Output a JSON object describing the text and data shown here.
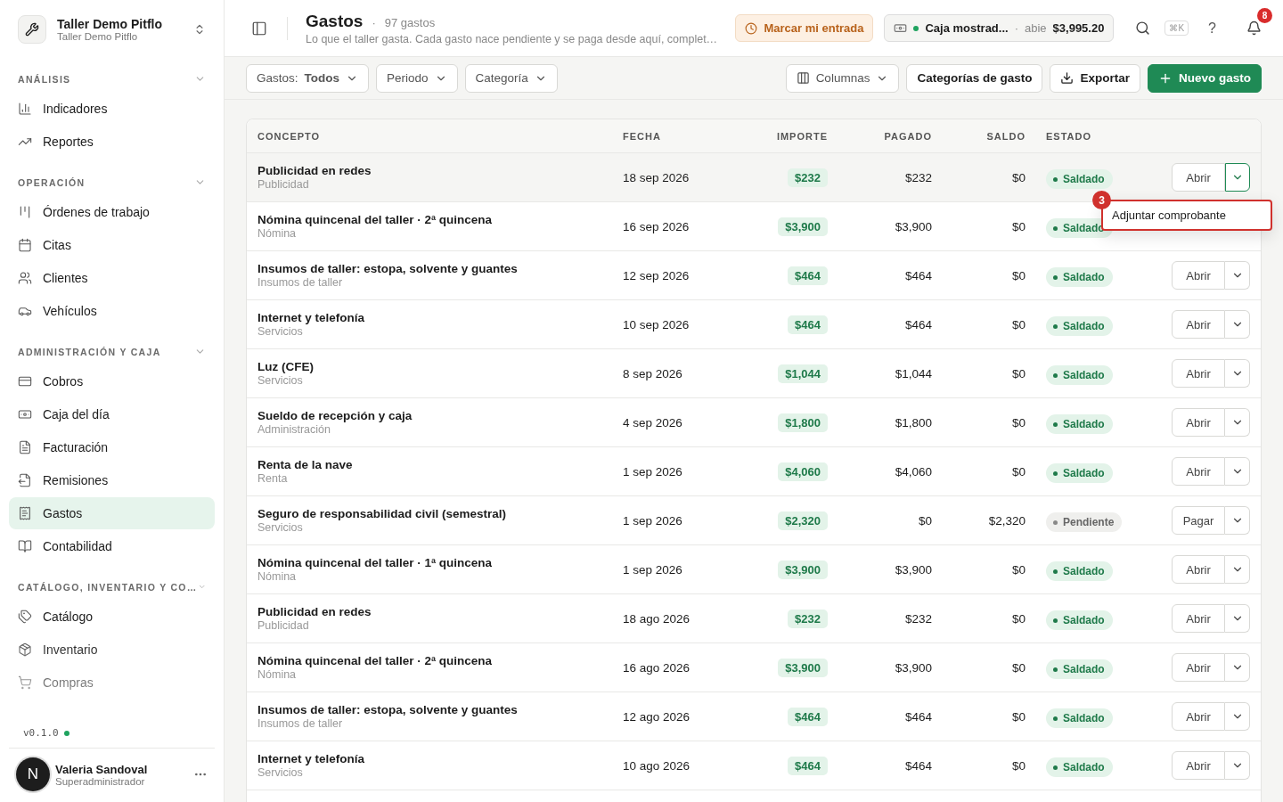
{
  "sidebar": {
    "workspace": {
      "name": "Taller Demo Pitflo",
      "subtitle": "Taller Demo Pitflo"
    },
    "sections": [
      {
        "title": "ANÁLISIS",
        "expanded": true,
        "items": [
          {
            "label": "Indicadores",
            "kind": "chart",
            "selected": false
          },
          {
            "label": "Reportes",
            "kind": "trend",
            "selected": false
          }
        ]
      },
      {
        "title": "OPERACIÓN",
        "expanded": true,
        "items": [
          {
            "label": "Órdenes de trabajo",
            "kind": "kanban",
            "selected": false
          },
          {
            "label": "Citas",
            "kind": "calendar",
            "selected": false
          },
          {
            "label": "Clientes",
            "kind": "users",
            "selected": false
          },
          {
            "label": "Vehículos",
            "kind": "car",
            "selected": false
          }
        ]
      },
      {
        "title": "ADMINISTRACIÓN Y CAJA",
        "expanded": true,
        "items": [
          {
            "label": "Cobros",
            "kind": "card",
            "selected": false
          },
          {
            "label": "Caja del día",
            "kind": "cash",
            "selected": false
          },
          {
            "label": "Facturación",
            "kind": "file",
            "selected": false
          },
          {
            "label": "Remisiones",
            "kind": "fileout",
            "selected": false
          },
          {
            "label": "Gastos",
            "kind": "receipt",
            "selected": true
          },
          {
            "label": "Contabilidad",
            "kind": "book",
            "selected": false
          }
        ]
      },
      {
        "title": "CATÁLOGO, INVENTARIO Y CO…",
        "expanded": true,
        "items": [
          {
            "label": "Catálogo",
            "kind": "tags",
            "selected": false
          },
          {
            "label": "Inventario",
            "kind": "box",
            "selected": false
          },
          {
            "label": "Compras",
            "kind": "cart",
            "selected": false
          }
        ]
      }
    ],
    "version": "v0.1.0",
    "user": {
      "initial": "N",
      "name": "Valeria Sandoval",
      "role": "Superadministrador"
    }
  },
  "header": {
    "title": "Gastos",
    "count_separator": "·",
    "count": "97 gastos",
    "subtitle": "Lo que el taller gasta. Cada gasto nace pendiente y se paga desde aquí, complet…",
    "clock_button": "Marcar mi entrada",
    "register": {
      "name": "Caja mostrad...",
      "separator": "·",
      "state": "abie",
      "amount": "$3,995.20"
    },
    "shortcut": "⌘K",
    "help": "?",
    "notifications": "8"
  },
  "toolbar": {
    "filters": [
      {
        "label": "Gastos:",
        "value": "Todos"
      },
      {
        "label": "Periodo"
      },
      {
        "label": "Categoría"
      }
    ],
    "columns_button": "Columnas",
    "categories_button": "Categorías de gasto",
    "export_button": "Exportar",
    "new_button": "Nuevo gasto"
  },
  "table": {
    "columns": [
      "CONCEPTO",
      "FECHA",
      "IMPORTE",
      "PAGADO",
      "SALDO",
      "ESTADO"
    ],
    "rows": [
      {
        "concept": "Publicidad en redes",
        "category": "Publicidad",
        "date": "18 sep 2026",
        "amount": "$232",
        "paid": "$232",
        "balance": "$0",
        "status": {
          "label": "Saldado",
          "kind": "paid"
        },
        "action": "Abrir",
        "selected": true,
        "menu": {
          "marker": "3",
          "items": [
            "Adjuntar comprobante"
          ]
        }
      },
      {
        "concept": "Nómina quincenal del taller · 2ª quincena",
        "category": "Nómina",
        "date": "16 sep 2026",
        "amount": "$3,900",
        "paid": "$3,900",
        "balance": "$0",
        "status": {
          "label": "Saldado",
          "kind": "paid"
        },
        "selected": false
      },
      {
        "concept": "Insumos de taller: estopa, solvente y guantes",
        "category": "Insumos de taller",
        "date": "12 sep 2026",
        "amount": "$464",
        "paid": "$464",
        "balance": "$0",
        "status": {
          "label": "Saldado",
          "kind": "paid"
        },
        "action": "Abrir",
        "selected": false
      },
      {
        "concept": "Internet y telefonía",
        "category": "Servicios",
        "date": "10 sep 2026",
        "amount": "$464",
        "paid": "$464",
        "balance": "$0",
        "status": {
          "label": "Saldado",
          "kind": "paid"
        },
        "action": "Abrir",
        "selected": false
      },
      {
        "concept": "Luz (CFE)",
        "category": "Servicios",
        "date": "8 sep 2026",
        "amount": "$1,044",
        "paid": "$1,044",
        "balance": "$0",
        "status": {
          "label": "Saldado",
          "kind": "paid"
        },
        "action": "Abrir",
        "selected": false
      },
      {
        "concept": "Sueldo de recepción y caja",
        "category": "Administración",
        "date": "4 sep 2026",
        "amount": "$1,800",
        "paid": "$1,800",
        "balance": "$0",
        "status": {
          "label": "Saldado",
          "kind": "paid"
        },
        "action": "Abrir",
        "selected": false
      },
      {
        "concept": "Renta de la nave",
        "category": "Renta",
        "date": "1 sep 2026",
        "amount": "$4,060",
        "paid": "$4,060",
        "balance": "$0",
        "status": {
          "label": "Saldado",
          "kind": "paid"
        },
        "action": "Abrir",
        "selected": false
      },
      {
        "concept": "Seguro de responsabilidad civil (semestral)",
        "category": "Servicios",
        "date": "1 sep 2026",
        "amount": "$2,320",
        "paid": "$0",
        "balance": "$2,320",
        "status": {
          "label": "Pendiente",
          "kind": "pending"
        },
        "action": "Pagar",
        "selected": false
      },
      {
        "concept": "Nómina quincenal del taller · 1ª quincena",
        "category": "Nómina",
        "date": "1 sep 2026",
        "amount": "$3,900",
        "paid": "$3,900",
        "balance": "$0",
        "status": {
          "label": "Saldado",
          "kind": "paid"
        },
        "action": "Abrir",
        "selected": false
      },
      {
        "concept": "Publicidad en redes",
        "category": "Publicidad",
        "date": "18 ago 2026",
        "amount": "$232",
        "paid": "$232",
        "balance": "$0",
        "status": {
          "label": "Saldado",
          "kind": "paid"
        },
        "action": "Abrir",
        "selected": false
      },
      {
        "concept": "Nómina quincenal del taller · 2ª quincena",
        "category": "Nómina",
        "date": "16 ago 2026",
        "amount": "$3,900",
        "paid": "$3,900",
        "balance": "$0",
        "status": {
          "label": "Saldado",
          "kind": "paid"
        },
        "action": "Abrir",
        "selected": false
      },
      {
        "concept": "Insumos de taller: estopa, solvente y guantes",
        "category": "Insumos de taller",
        "date": "12 ago 2026",
        "amount": "$464",
        "paid": "$464",
        "balance": "$0",
        "status": {
          "label": "Saldado",
          "kind": "paid"
        },
        "action": "Abrir",
        "selected": false
      },
      {
        "concept": "Internet y telefonía",
        "category": "Servicios",
        "date": "10 ago 2026",
        "amount": "$464",
        "paid": "$464",
        "balance": "$0",
        "status": {
          "label": "Saldado",
          "kind": "paid"
        },
        "action": "Abrir",
        "selected": false
      }
    ]
  }
}
